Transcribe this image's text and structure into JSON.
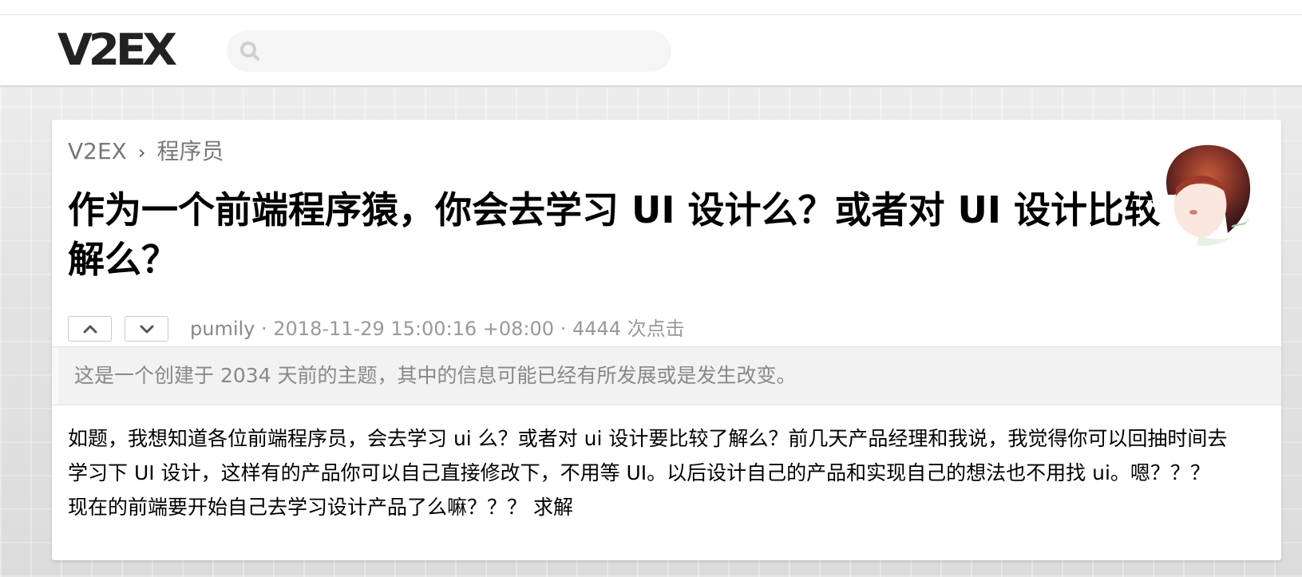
{
  "header": {
    "logo": "V2EX",
    "search_placeholder": ""
  },
  "breadcrumb": {
    "home": "V2EX",
    "separator": "›",
    "node": "程序员"
  },
  "topic": {
    "title": "作为一个前端程序猿，你会去学习 UI 设计么？或者对 UI 设计比较了解么？",
    "author": "pumily",
    "meta_rest": " · 2018-11-29 15:00:16 +08:00 · 4444 次点击",
    "notice": "这是一个创建于 2034 天前的主题，其中的信息可能已经有所发展或是发生改变。",
    "content": "如题，我想知道各位前端程序员，会去学习 ui 么？或者对 ui 设计要比较了解么？前几天产品经理和我说，我觉得你可以回抽时间去学习下 UI 设计，这样有的产品你可以自己直接修改下，不用等 UI。以后设计自己的产品和实现自己的想法也不用找 ui。嗯？？？ 现在的前端要开始自己去学习设计产品了么嘛？？？ 求解"
  },
  "icons": {
    "search": "search-icon",
    "upvote": "chevron-up-icon",
    "downvote": "chevron-down-icon",
    "avatar": "author-avatar"
  },
  "colors": {
    "text_primary": "#000000",
    "text_muted": "#999999",
    "notice_bg": "#f2f2f2",
    "page_bg": "#e2e2e2"
  }
}
